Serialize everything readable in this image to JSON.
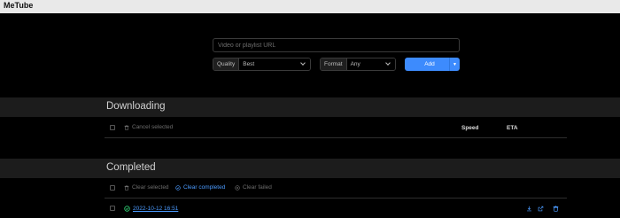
{
  "window": {
    "title": "MeTube"
  },
  "form": {
    "url_placeholder": "Video or playlist URL",
    "quality_label": "Quality",
    "quality_value": "Best",
    "format_label": "Format",
    "format_value": "Any",
    "add_label": "Add"
  },
  "downloading": {
    "title": "Downloading",
    "cancel_selected": "Cancel selected",
    "col_speed": "Speed",
    "col_eta": "ETA"
  },
  "completed": {
    "title": "Completed",
    "clear_selected": "Clear selected",
    "clear_completed": "Clear completed",
    "clear_failed": "Clear failed",
    "items": [
      {
        "title": "2022-10-12 16:51",
        "status": "completed"
      }
    ]
  },
  "colors": {
    "accent": "#3d8bfd",
    "link": "#4b9bff",
    "success": "#2ecc71",
    "band": "#1c1c1c"
  }
}
